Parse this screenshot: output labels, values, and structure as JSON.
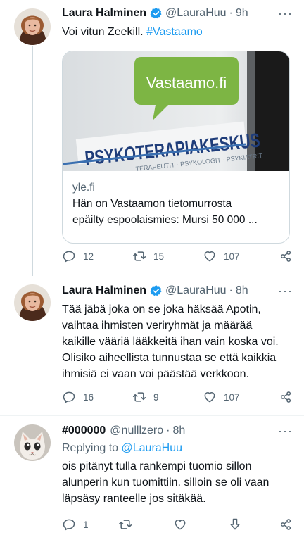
{
  "tweets": [
    {
      "name": "Laura Halminen",
      "handle": "@LauraHuu",
      "dot": "·",
      "time": "9h",
      "text_plain": "Voi vitun Zeekill.",
      "hashtag": "#Vastaamo",
      "card": {
        "image_sign": "Vastaamo.fi",
        "image_banner": "PSYKOTERAPIAKESKUS",
        "image_banner_sub": "TERAPEUTIT · PSYKOLOGIT · PSYKIATRIT",
        "domain": "yle.fi",
        "title_line1": "Hän on Vastaamon tietomurrosta",
        "title_line2": "epäilty espoolaismies: Mursi 50 000 ..."
      },
      "reply_count": "12",
      "retweet_count": "15",
      "like_count": "107"
    },
    {
      "name": "Laura Halminen",
      "handle": "@LauraHuu",
      "dot": "·",
      "time": "8h",
      "lines": [
        "Tää jäbä joka on se joka häksää Apotin,",
        "vaihtaa ihmisten veriryhmät ja määrää",
        "kaikille vääriä lääkkeitä ihan vain koska voi.",
        "Olisiko aiheellista tunnustaa se että kaikkia",
        "ihmisiä ei vaan voi päästää verkkoon."
      ],
      "reply_count": "16",
      "retweet_count": "9",
      "like_count": "107"
    },
    {
      "name": "#000000",
      "handle": "@nulllzero",
      "dot": "·",
      "time": "8h",
      "replying_prefix": "Replying to ",
      "replying_to": "@LauraHuu",
      "lines": [
        "ois pitänyt tulla rankempi tuomio sillon",
        "alunperin kun tuomittiin. silloin se oli vaan",
        "läpsäsy ranteelle jos sitäkää."
      ],
      "reply_count": "1"
    }
  ],
  "more_label": "···",
  "colors": {
    "link": "#1d9bf0",
    "verified": "#1d9bf0",
    "muted": "#536471",
    "text": "#0f1419",
    "brand_green": "#6aa84f"
  }
}
